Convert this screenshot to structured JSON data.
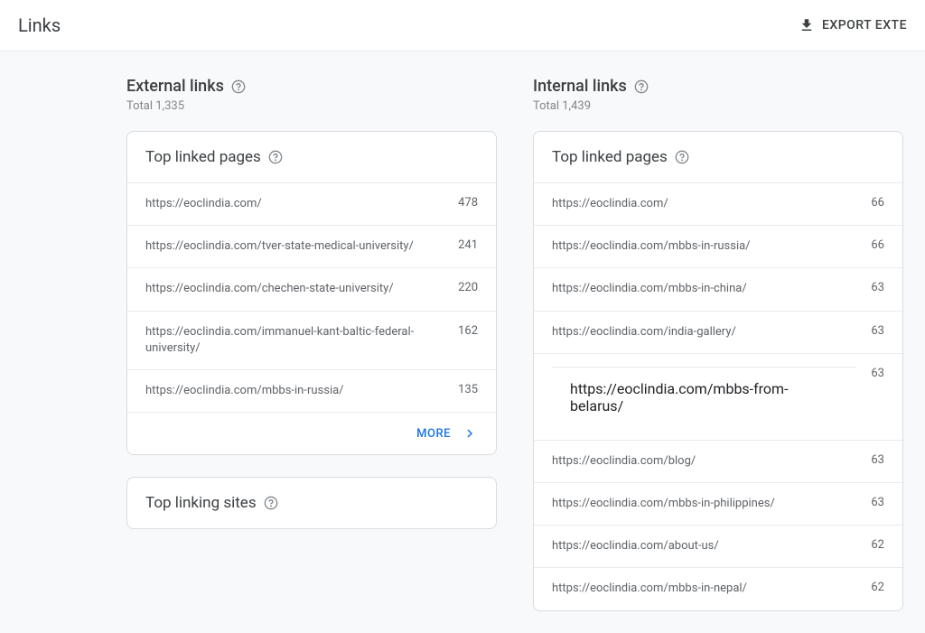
{
  "header": {
    "title": "Links",
    "export_label": "EXPORT EXTE"
  },
  "external": {
    "title": "External links",
    "total_label": "Total 1,335",
    "card1": {
      "title": "Top linked pages",
      "more_label": "MORE",
      "rows": [
        {
          "url": "https://eoclindia.com/",
          "count": "478"
        },
        {
          "url": "https://eoclindia.com/tver-state-medical-university/",
          "count": "241"
        },
        {
          "url": "https://eoclindia.com/chechen-state-university/",
          "count": "220"
        },
        {
          "url": "https://eoclindia.com/immanuel-kant-baltic-federal-university/",
          "count": "162"
        },
        {
          "url": "https://eoclindia.com/mbbs-in-russia/",
          "count": "135"
        }
      ]
    },
    "card2": {
      "title": "Top linking sites"
    }
  },
  "internal": {
    "title": "Internal links",
    "total_label": "Total 1,439",
    "card1": {
      "title": "Top linked pages",
      "rows": [
        {
          "url": "https://eoclindia.com/",
          "count": "66"
        },
        {
          "url": "https://eoclindia.com/mbbs-in-russia/",
          "count": "66"
        },
        {
          "url": "https://eoclindia.com/mbbs-in-china/",
          "count": "63"
        },
        {
          "url": "https://eoclindia.com/india-gallery/",
          "count": "63"
        },
        {
          "url": "https://eoclindia.com/mbbs-from-belarus/",
          "count": "63"
        },
        {
          "url": "https://eoclindia.com/blog/",
          "count": "63"
        },
        {
          "url": "https://eoclindia.com/mbbs-in-philippines/",
          "count": "63"
        },
        {
          "url": "https://eoclindia.com/about-us/",
          "count": "62"
        },
        {
          "url": "https://eoclindia.com/mbbs-in-nepal/",
          "count": "62"
        }
      ]
    }
  }
}
